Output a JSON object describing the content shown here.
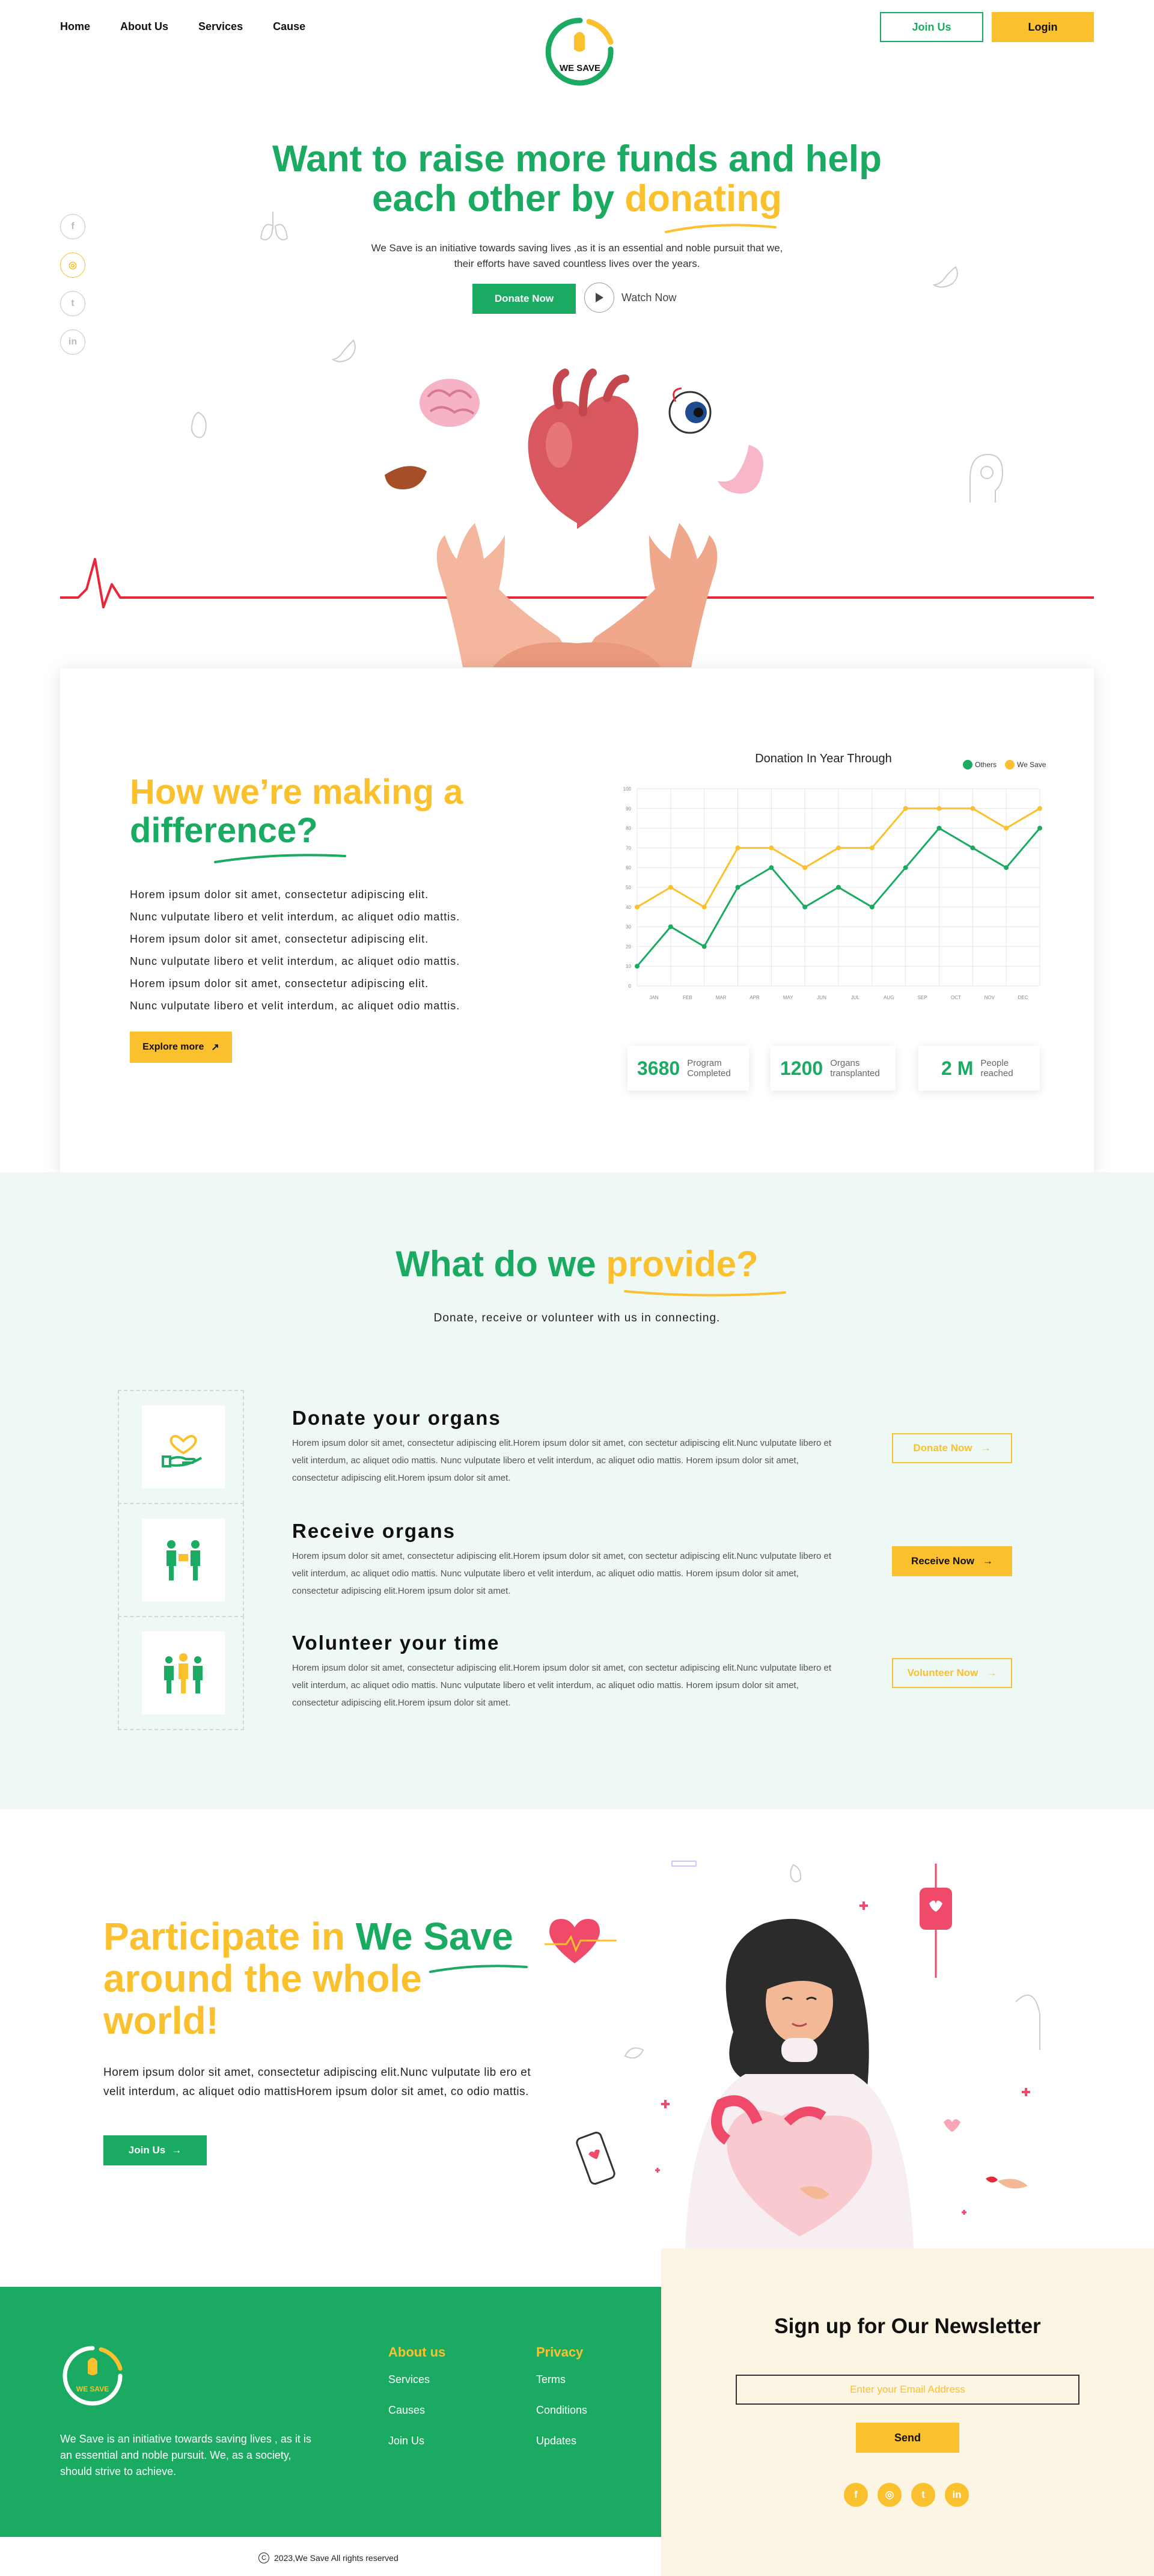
{
  "nav": {
    "items": [
      "Home",
      "About Us",
      "Services",
      "Cause"
    ],
    "logo_text": "WE SAVE",
    "join_label": "Join Us",
    "login_label": "Login"
  },
  "hero": {
    "title_line1": "Want to raise more funds and help",
    "title_line2_a": "each other by ",
    "title_line2_b": "donating",
    "subtitle_line1": "We Save is an initiative towards saving lives ,as it is an essential and noble pursuit that we,",
    "subtitle_line2": "their efforts have saved countless lives over the years.",
    "donate_label": "Donate Now",
    "watch_label": "Watch Now",
    "social_icons": [
      "facebook-icon",
      "instagram-icon",
      "twitter-icon",
      "linkedin-icon"
    ]
  },
  "difference": {
    "title_a": "How we’re making a",
    "title_b": "difference?",
    "lines": [
      "Horem ipsum dolor sit amet, consectetur adipiscing elit.",
      "Nunc vulputate libero et velit interdum, ac aliquet odio mattis.",
      "Horem ipsum dolor sit amet, consectetur adipiscing elit.",
      "Nunc vulputate libero et velit interdum, ac aliquet odio mattis.",
      "Horem ipsum dolor sit amet, consectetur adipiscing elit.",
      "Nunc vulputate libero et velit interdum, ac aliquet odio mattis."
    ],
    "explore_label": "Explore more",
    "stats": [
      {
        "num": "3680",
        "label1": "Program",
        "label2": "Completed"
      },
      {
        "num": "1200",
        "label1": "Organs",
        "label2": "transplanted"
      },
      {
        "num": "2 M",
        "label1": "People",
        "label2": "reached"
      }
    ]
  },
  "chart_data": {
    "type": "line",
    "title": "Donation In Year Through",
    "categories": [
      "JAN",
      "FEB",
      "MAR",
      "APR",
      "MAY",
      "JUN",
      "JUL",
      "AUG",
      "SEP",
      "OCT",
      "NOV",
      "DEC"
    ],
    "yticks": [
      0,
      10,
      20,
      30,
      40,
      50,
      60,
      70,
      80,
      90,
      100
    ],
    "ylim": [
      0,
      100
    ],
    "legend_position": "top-right",
    "series": [
      {
        "name": "Others",
        "color": "#1aaa62",
        "values": [
          10,
          30,
          20,
          50,
          60,
          40,
          50,
          40,
          60,
          80,
          70,
          60,
          80
        ]
      },
      {
        "name": "We Save",
        "color": "#fbc02d",
        "values": [
          40,
          50,
          40,
          70,
          70,
          60,
          70,
          70,
          90,
          90,
          90,
          80,
          90
        ]
      }
    ]
  },
  "provide": {
    "title_a": "What do we ",
    "title_b": "provide?",
    "subtitle": "Donate, receive or volunteer with us in connecting.",
    "items": [
      {
        "title": "Donate your organs",
        "text": "Horem ipsum dolor sit amet, consectetur adipiscing elit.Horem ipsum dolor sit amet, con sectetur adipiscing elit.Nunc vulputate libero et velit interdum, ac aliquet odio mattis. Nunc vulputate libero et velit interdum, ac aliquet odio mattis. Horem ipsum dolor sit amet, consectetur adipiscing elit.Horem ipsum dolor sit amet.",
        "button": "Donate Now"
      },
      {
        "title": "Receive organs",
        "text": "Horem ipsum dolor sit amet, consectetur adipiscing elit.Horem ipsum dolor sit amet, con sectetur adipiscing elit.Nunc vulputate libero et velit interdum, ac aliquet odio mattis. Nunc vulputate libero et velit interdum, ac aliquet odio mattis. Horem ipsum dolor sit amet, consectetur adipiscing elit.Horem ipsum dolor sit amet.",
        "button": "Receive Now"
      },
      {
        "title": "Volunteer your time",
        "text": "Horem ipsum dolor sit amet, consectetur adipiscing elit.Horem ipsum dolor sit amet, con sectetur adipiscing elit.Nunc vulputate libero et velit interdum, ac aliquet odio mattis. Nunc vulputate libero et velit interdum, ac aliquet odio mattis. Horem ipsum dolor sit amet, consectetur adipiscing elit.Horem ipsum dolor sit amet.",
        "button": "Volunteer Now"
      }
    ]
  },
  "participate": {
    "title_a": "Participate in ",
    "title_b": "We Save",
    "title_c": "around the whole",
    "title_d": "world!",
    "text": "Horem ipsum dolor sit amet, consectetur adipiscing elit.Nunc vulputate lib ero et velit interdum, ac aliquet odio mattisHorem ipsum dolor sit amet, co odio mattis.",
    "join_label": "Join Us"
  },
  "footer": {
    "logo_text": "WE SAVE",
    "about": "We Save is an initiative towards saving lives , as it is an essential and noble pursuit. We, as a society, should strive to achieve.",
    "col1": {
      "heading": "About us",
      "items": [
        "Services",
        "Causes",
        "Join Us"
      ]
    },
    "col2": {
      "heading": "Privacy",
      "items": [
        "Terms",
        "Conditions",
        "Updates"
      ]
    },
    "newsletter_title": "Sign up for Our Newsletter",
    "email_placeholder": "Enter your Email Address",
    "send_label": "Send",
    "copyright": "2023,We Save All rights reserved"
  },
  "colors": {
    "green": "#1aaa62",
    "yellow": "#fbc02d",
    "red": "#e8283a",
    "mint": "#eef8f4",
    "cream": "#fdf5e4"
  }
}
